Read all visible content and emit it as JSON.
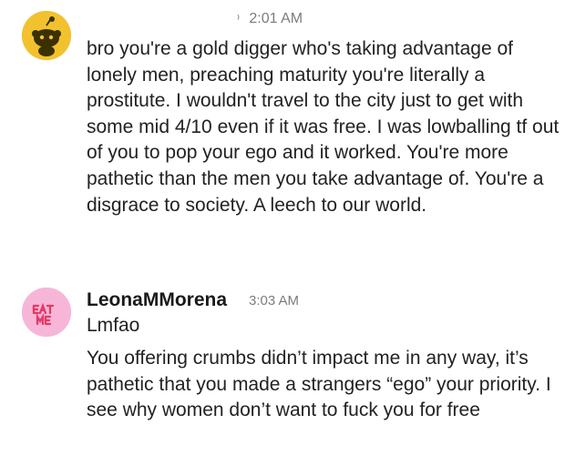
{
  "messages": [
    {
      "avatar": "reddit-snoo-icon",
      "time": "2:01 AM",
      "text": "bro you're a gold digger who's taking advantage of lonely men, preaching maturity you're literally a prostitute. I wouldn't travel to the city just to get with some mid 4/10 even if it was free. I was lowballing tf out of you to pop your ego and it worked. You're more pathetic than the men you take advantage of. You're a disgrace to society. A leech to our world."
    },
    {
      "avatar": "eat-me-icon",
      "avatar_text": "EAT ME",
      "username": "LeonaMMorena",
      "time": "3:03 AM",
      "lines": [
        "Lmfao",
        "You offering crumbs didn’t impact me in any way, it’s pathetic that you made a strangers “ego” your priority. I see why women don’t want to fuck you for free"
      ]
    }
  ],
  "colors": {
    "snoo_bg": "#f2c12e",
    "eatme_bg": "#f7b6d8",
    "eatme_text": "#e23b68"
  }
}
